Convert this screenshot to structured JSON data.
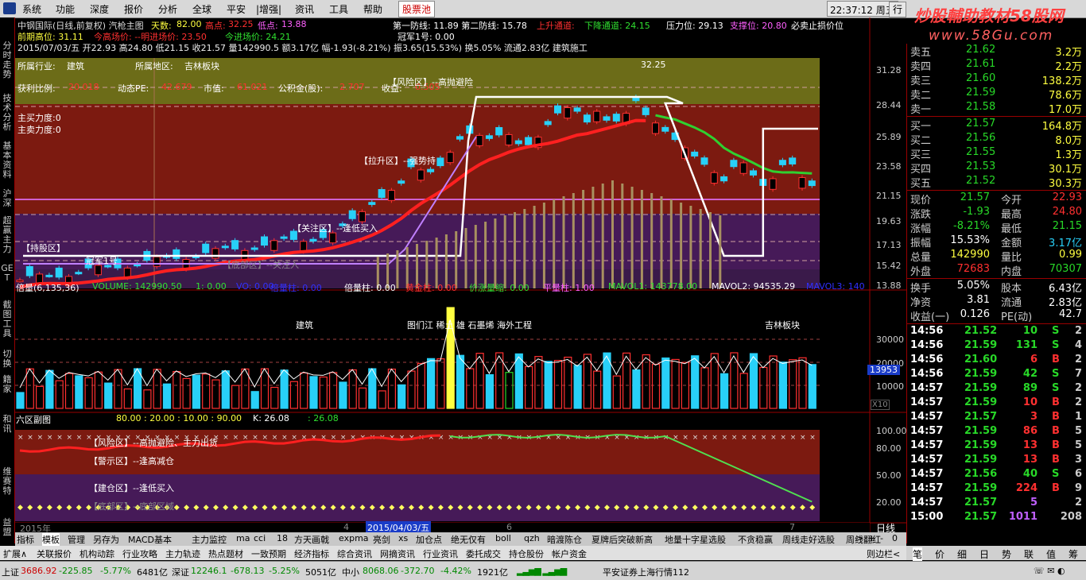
{
  "menu": {
    "items": [
      "系统",
      "功能",
      "深度",
      "报价",
      "分析",
      "全球",
      "平安",
      "|增强|",
      "资讯",
      "工具",
      "帮助"
    ],
    "stock_pool": "股票池",
    "clock": "22:37:12 周五",
    "right_btn": "行"
  },
  "watermark": {
    "main": "炒股輔助教材58股网",
    "url": "www.58Gu.com"
  },
  "left_tabs": [
    "分时走势",
    "技术分析",
    "基本资料",
    "沪深",
    "超赢主力",
    "GET",
    "截图工具",
    "切换",
    "籍家",
    "和讯",
    "维赛特",
    "益盟"
  ],
  "header": {
    "line1": "中钢国际(日线,前复权) 汽枪主图",
    "tianshu_label": "天数:",
    "tianshu": "82.00",
    "gaodian_label": "高点:",
    "gaodian": "32.25",
    "didian_label": "低点:",
    "didian": "13.88",
    "line1b": "第一防线: 11.89  第二防线: 15.78",
    "up_channel": "上升通道:",
    "down_channel": "下降通道: 24.15",
    "pressure": "压力位: 29.13",
    "support": "支撑位: 20.80",
    "must_sell": "必卖止损价位",
    "line2a": "前期高位: 31.11",
    "line2b": "今高场价: --明进场价: 23.50",
    "line2c": "今进场价: 24.21",
    "guanjun": "冠军1号: 0.00",
    "line3": "2015/07/03/五 开22.93 高24.80 低21.15 收21.57 量142990.5 额3.17亿 幅-1.93(-8.21%) 振3.65(15.53%) 换5.05% 流通2.83亿 建筑施工"
  },
  "info_box": {
    "industry_label": "所属行业:",
    "industry": "建筑",
    "region_label": "所属地区:",
    "region": "吉林板块",
    "pe_ratio_label": "获利比例:",
    "pe_ratio": "20.018",
    "dyn_pe_label": "动态PE:",
    "dyn_pe": "42.679",
    "mkt_label": "市值:",
    "mkt": "61.021",
    "fund_label": "公积金(股):",
    "fund": "2.707",
    "income_label": "收益:",
    "income": "0.505",
    "buy_force": "主买力度:0",
    "sell_force": "主卖力度:0"
  },
  "zones": {
    "risk": "【风险区】--高抛避险",
    "rise": "【拉升区】--强势持",
    "watch": "【关注区】--逢低买入",
    "hold": "【持股区】",
    "champion": "冠军1号",
    "bottom": "【底部区】--关注入",
    "high_mark": "32.25"
  },
  "price_axis": [
    "31.28",
    "28.44",
    "25.89",
    "23.58",
    "21.15",
    "19.63",
    "17.13",
    "15.42",
    "13.88"
  ],
  "volume_header": {
    "title": "倍量(6,135,36)",
    "volume": "VOLUME: 142990.50",
    "v1": "1: 0.00",
    "vo": "VO: 0.00",
    "beiliang": "倍量柱: 0.00",
    "huangjin": "黄金柱: 0.00",
    "jiazhang": "价涨量缩: 0.00",
    "pingliang": "平量柱: 1.00",
    "mavol1": "MAVOL1: 143778.00",
    "mavol2": "MAVOL2: 94535.29",
    "mavol3": "MAVOL3: 140"
  },
  "volume_notes": {
    "a": "建筑",
    "b": "图们江 稀土 雄 石墨烯 海外工程",
    "c": "吉林板块"
  },
  "volume_axis": [
    "30000",
    "20000",
    "10000"
  ],
  "volume_badge": "13953",
  "volume_unit": "X10",
  "ind_header": {
    "title": "六区副图",
    "vals": "80.00 : 20.00 : 10.00 : 90.00",
    "k": "K: 26.08",
    "k2": ": 26.08"
  },
  "ind_zones": {
    "risk": "【风险区】--高抛避险、主力出货",
    "warn": "【警示区】--逢高减仓",
    "build": "【建仓区】--逢低买入",
    "bottom": "【底部区】--底部区域"
  },
  "ind_axis": [
    "100.00",
    "80.00",
    "50.00",
    "20.00"
  ],
  "date_axis": {
    "y2015": "2015年",
    "m4": "4",
    "d": "2015/04/03/五",
    "m6": "6",
    "m7": "7",
    "period": "日线"
  },
  "quote": {
    "sell": [
      {
        "label": "卖五",
        "price": "21.62",
        "vol": "3.2万"
      },
      {
        "label": "卖四",
        "price": "21.61",
        "vol": "2.2万"
      },
      {
        "label": "卖三",
        "price": "21.60",
        "vol": "138.2万"
      },
      {
        "label": "卖二",
        "price": "21.59",
        "vol": "78.6万"
      },
      {
        "label": "卖一",
        "price": "21.58",
        "vol": "17.0万"
      }
    ],
    "buy": [
      {
        "label": "买一",
        "price": "21.57",
        "vol": "164.8万"
      },
      {
        "label": "买二",
        "price": "21.56",
        "vol": "8.0万"
      },
      {
        "label": "买三",
        "price": "21.55",
        "vol": "1.3万"
      },
      {
        "label": "买四",
        "price": "21.53",
        "vol": "30.1万"
      },
      {
        "label": "买五",
        "price": "21.52",
        "vol": "30.3万"
      }
    ],
    "stats": [
      {
        "l1": "现价",
        "v1": "21.57",
        "l2": "今开",
        "v2": "22.93"
      },
      {
        "l1": "涨跌",
        "v1": "-1.93",
        "l2": "最高",
        "v2": "24.80"
      },
      {
        "l1": "涨幅",
        "v1": "-8.21%",
        "l2": "最低",
        "v2": "21.15"
      },
      {
        "l1": "振幅",
        "v1": "15.53%",
        "l2": "金额",
        "v2": "3.17亿"
      },
      {
        "l1": "总量",
        "v1": "142990",
        "l2": "量比",
        "v2": "0.99"
      },
      {
        "l1": "外盘",
        "v1": "72683",
        "l2": "内盘",
        "v2": "70307"
      }
    ],
    "stats2": [
      {
        "l1": "换手",
        "v1": "5.05%",
        "l2": "股本",
        "v2": "6.43亿"
      },
      {
        "l1": "净资",
        "v1": "3.81",
        "l2": "流通",
        "v2": "2.83亿"
      },
      {
        "l1": "收益(一)",
        "v1": "0.126",
        "l2": "PE(动)",
        "v2": "42.7"
      }
    ],
    "ticks": [
      {
        "t": "14:56",
        "p": "21.52",
        "v": "10",
        "s": "S",
        "n": "2"
      },
      {
        "t": "14:56",
        "p": "21.59",
        "v": "131",
        "s": "S",
        "n": "4"
      },
      {
        "t": "14:56",
        "p": "21.60",
        "v": "6",
        "s": "B",
        "n": "2"
      },
      {
        "t": "14:56",
        "p": "21.59",
        "v": "42",
        "s": "S",
        "n": "7"
      },
      {
        "t": "14:57",
        "p": "21.59",
        "v": "89",
        "s": "S",
        "n": "2"
      },
      {
        "t": "14:57",
        "p": "21.59",
        "v": "10",
        "s": "B",
        "n": "2"
      },
      {
        "t": "14:57",
        "p": "21.57",
        "v": "3",
        "s": "B",
        "n": "1"
      },
      {
        "t": "14:57",
        "p": "21.59",
        "v": "86",
        "s": "B",
        "n": "5"
      },
      {
        "t": "14:57",
        "p": "21.59",
        "v": "13",
        "s": "B",
        "n": "5"
      },
      {
        "t": "14:57",
        "p": "21.59",
        "v": "13",
        "s": "B",
        "n": "3"
      },
      {
        "t": "14:57",
        "p": "21.56",
        "v": "40",
        "s": "S",
        "n": "6"
      },
      {
        "t": "14:57",
        "p": "21.59",
        "v": "224",
        "s": "B",
        "n": "9"
      },
      {
        "t": "14:57",
        "p": "21.57",
        "v": "5",
        "s": "",
        "n": "2"
      },
      {
        "t": "15:00",
        "p": "21.57",
        "v": "1011",
        "s": "",
        "n": "208"
      }
    ]
  },
  "tabs1": [
    "指标",
    "模板",
    "管理",
    "另存为",
    "MACD基本",
    "主力监控",
    "ma",
    "cci",
    "18",
    "方天画戟",
    "expma",
    "亮剑",
    "xs",
    "加仓点",
    "绝无仅有",
    "boll",
    "qzh",
    "暗渡陈仓",
    "夏牌后突破新高",
    "地量十字星选股",
    "不贪稳赢",
    "周线走好选股",
    "周线翻红"
  ],
  "tabs1_extra": [
    ">",
    "+",
    "-",
    "0"
  ],
  "tabs2": [
    "扩展∧",
    "关联报价",
    "机构动踪",
    "行业攻略",
    "主力轨迹",
    "热点题材",
    "一致预期",
    "经济指标",
    "综合资讯",
    "网摘资讯",
    "行业资讯",
    "委托成交",
    "持仓股份",
    "帐户资金"
  ],
  "tabs2_right": "则边栏<",
  "right_tabs": [
    "笔",
    "价",
    "细",
    "日",
    "势",
    "联",
    "值",
    "筹"
  ],
  "status": {
    "sh_label": "上证",
    "sh": "3686.92",
    "sh_chg": "-225.85",
    "sh_pct": "-5.77%",
    "sh_amt": "6481亿",
    "sz_label": "深证",
    "sz": "12246.1",
    "sz_chg": "-678.13",
    "sz_pct": "-5.25%",
    "sz_amt": "5051亿",
    "zx_label": "中小",
    "zx": "8068.06",
    "zx_chg": "-372.70",
    "zx_pct": "-4.42%",
    "zx_amt": "1921亿",
    "broker": "平安证券上海行情112"
  },
  "colors": {
    "up": "#ff3b3b",
    "down": "#28d8f8",
    "green": "#28d828",
    "yellow": "#ffff40",
    "red_zone": "#8a1a10",
    "purple_zone": "#4a1a5e",
    "olive_zone": "#6a6a20"
  }
}
